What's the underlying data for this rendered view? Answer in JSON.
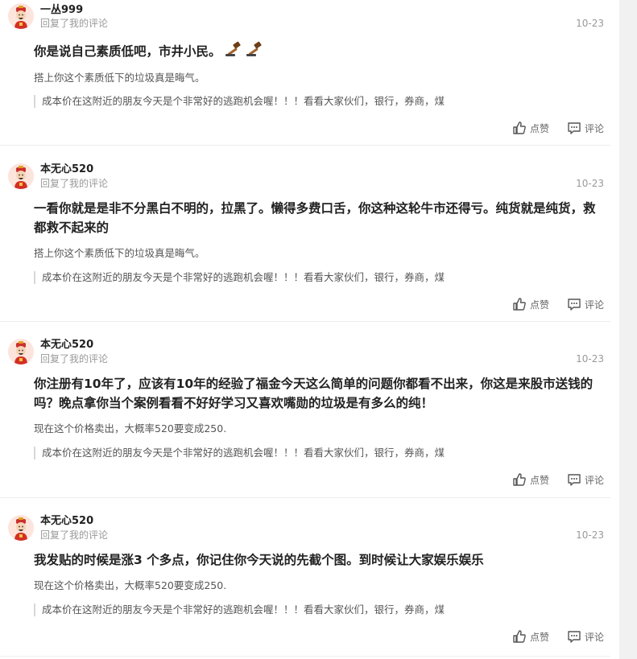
{
  "comments": [
    {
      "username": "一丛999",
      "sub": "回复了我的评论",
      "date": "10-23",
      "content": "你是说自己素质低吧，市井小民。",
      "content_emoji": [
        "gavel",
        "gavel"
      ],
      "quote": "搭上你这个素质低下的垃圾真是晦气。",
      "original": "成本价在这附近的朋友今天是个非常好的逃跑机会喔！！！看看大家伙们，银行，券商，煤",
      "like_label": "点赞",
      "comment_label": "评论"
    },
    {
      "username": "本无心520",
      "sub": "回复了我的评论",
      "date": "10-23",
      "content": "一看你就是是非不分黑白不明的，拉黑了。懒得多费口舌，你这种这轮牛市还得亏。纯货就是纯货，救都救不起来的",
      "quote": "搭上你这个素质低下的垃圾真是晦气。",
      "original": "成本价在这附近的朋友今天是个非常好的逃跑机会喔！！！看看大家伙们，银行，券商，煤",
      "like_label": "点赞",
      "comment_label": "评论"
    },
    {
      "username": "本无心520",
      "sub": "回复了我的评论",
      "date": "10-23",
      "content": "你注册有10年了，应该有10年的经验了福金今天这么简单的问题你都看不出来，你这是来股市送钱的吗？晚点拿你当个案例看看不好好学习又喜欢嘴勋的垃圾是有多么的纯！",
      "quote": "现在这个价格卖出，大概率520要变成250.",
      "original": "成本价在这附近的朋友今天是个非常好的逃跑机会喔！！！看看大家伙们，银行，券商，煤",
      "like_label": "点赞",
      "comment_label": "评论"
    },
    {
      "username": "本无心520",
      "sub": "回复了我的评论",
      "date": "10-23",
      "content": "我发贴的时候是涨3 个多点，你记住你今天说的先截个图。到时候让大家娱乐娱乐",
      "quote": "现在这个价格卖出，大概率520要变成250.",
      "original": "成本价在这附近的朋友今天是个非常好的逃跑机会喔！！！看看大家伙们，银行，券商，煤",
      "like_label": "点赞",
      "comment_label": "评论"
    }
  ],
  "colors": {
    "username": "#222222",
    "meta": "#999999",
    "content": "#222222",
    "divider": "#eeeeee",
    "quote_bar": "#d8d8d8"
  },
  "icons": {
    "avatar": "caishen-avatar-icon",
    "like": "thumbs-up-icon",
    "comment": "comment-bubble-icon",
    "emoji": "gavel-icon"
  }
}
